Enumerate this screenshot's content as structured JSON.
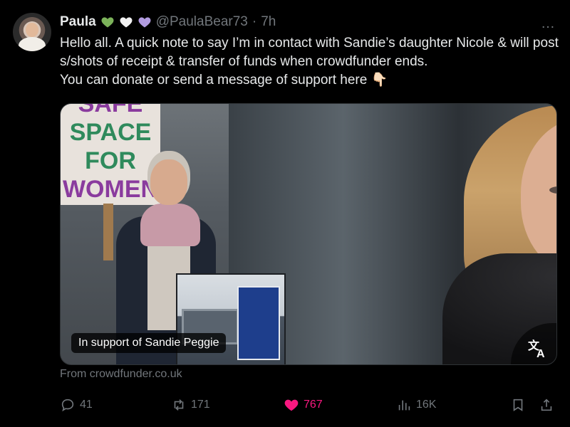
{
  "tweet": {
    "author_name": "Paula",
    "handle": "@PaulaBear73",
    "separator": "·",
    "time": "7h",
    "text": "Hello all.  A quick note to say I’m in contact with Sandie’s daughter Nicole & will post s/shots of receipt & transfer of funds when crowdfunder ends.\nYou can donate or send a message of support here 👇🏻",
    "name_emojis": [
      "green-heart-icon",
      "white-heart-icon",
      "purple-heart-icon"
    ],
    "more_icon": "…"
  },
  "card": {
    "caption": "In support of Sandie Peggie",
    "source": "From crowdfunder.co.uk",
    "sign_lines": [
      "SAFE",
      "SPACE",
      "FOR",
      "WOMEN"
    ]
  },
  "actions": {
    "replies": "41",
    "reposts": "171",
    "likes": "767",
    "views": "16K"
  },
  "colors": {
    "background": "#000000",
    "text": "#e7e9ea",
    "muted": "#71767b",
    "like": "#f91880",
    "green_heart": "#7cb35a",
    "purple_heart": "#b29ce0"
  }
}
